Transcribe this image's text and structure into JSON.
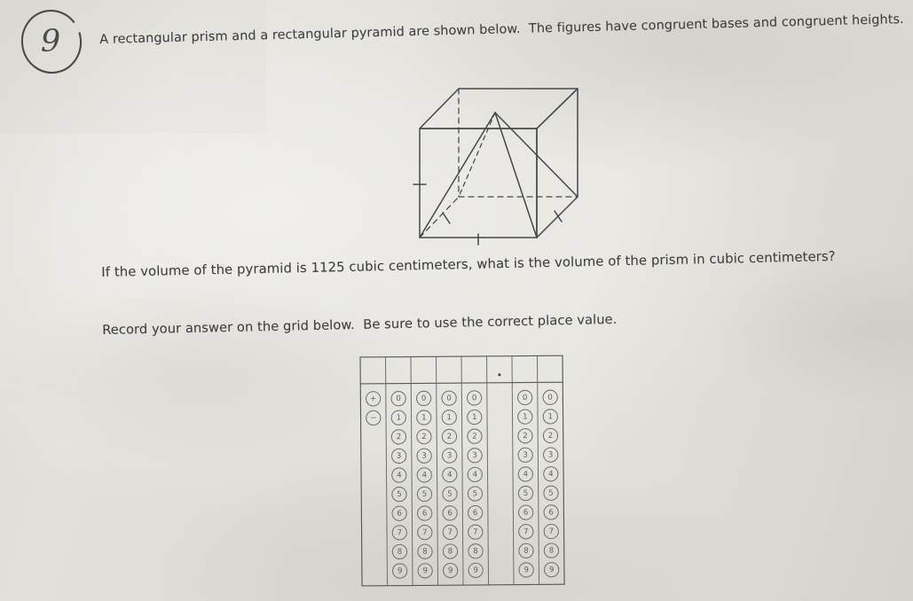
{
  "page": {
    "handwritten_mark": "9",
    "question_text_1": "A rectangular prism and a rectangular pyramid are shown below.  The figures have congruent bases and congruent heights.",
    "question_text_2": "If the volume of the pyramid is 1125 cubic centimeters, what is the volume of the prism in cubic centimeters?",
    "question_text_3": "Record your answer on the grid below.  Be sure to use the correct place value.",
    "ink_color": "#3e3f41",
    "paper_color": "#dedcd6"
  },
  "figure": {
    "name": "rectangular-prism-with-inscribed-pyramid",
    "description": "A rectangular prism drawn in perspective with a rectangular pyramid inscribed inside it; hidden edges dashed; congruence tick marks on base and height edges.",
    "line_color": "#45484b"
  },
  "answer_grid": {
    "columns": [
      {
        "type": "sign",
        "bubbles": [
          "+",
          "−"
        ]
      },
      {
        "type": "digit",
        "bubbles": [
          "0",
          "1",
          "2",
          "3",
          "4",
          "5",
          "6",
          "7",
          "8",
          "9"
        ]
      },
      {
        "type": "digit",
        "bubbles": [
          "0",
          "1",
          "2",
          "3",
          "4",
          "5",
          "6",
          "7",
          "8",
          "9"
        ]
      },
      {
        "type": "digit",
        "bubbles": [
          "0",
          "1",
          "2",
          "3",
          "4",
          "5",
          "6",
          "7",
          "8",
          "9"
        ]
      },
      {
        "type": "digit",
        "bubbles": [
          "0",
          "1",
          "2",
          "3",
          "4",
          "5",
          "6",
          "7",
          "8",
          "9"
        ]
      },
      {
        "type": "decimal",
        "bubbles": [
          "."
        ]
      },
      {
        "type": "digit",
        "bubbles": [
          "0",
          "1",
          "2",
          "3",
          "4",
          "5",
          "6",
          "7",
          "8",
          "9"
        ]
      },
      {
        "type": "digit",
        "bubbles": [
          "0",
          "1",
          "2",
          "3",
          "4",
          "5",
          "6",
          "7",
          "8",
          "9"
        ]
      }
    ],
    "write_in_row_values": [
      "",
      "",
      "",
      "",
      "",
      ".",
      "",
      ""
    ],
    "decimal_point_glyph": "."
  }
}
